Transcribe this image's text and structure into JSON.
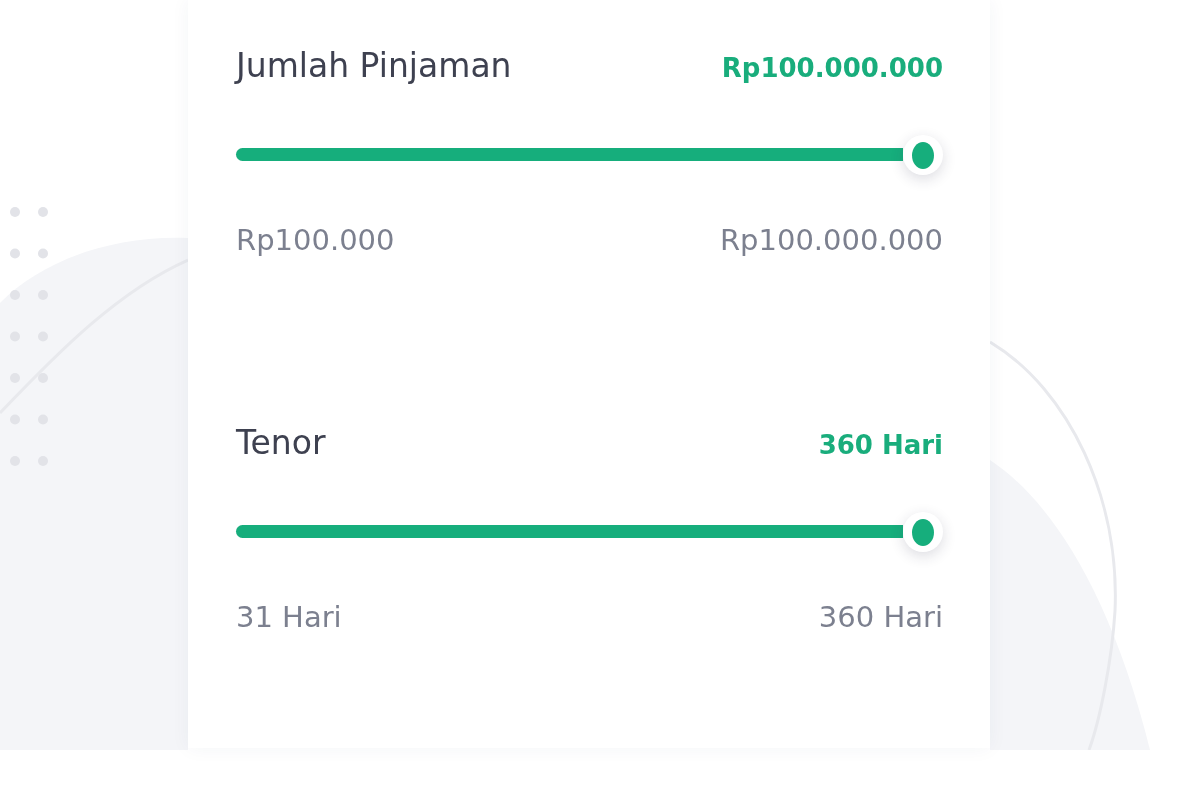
{
  "sliders": [
    {
      "label": "Jumlah Pinjaman",
      "value": "Rp100.000.000",
      "level": 1,
      "min_label": "Rp100.000",
      "max_label": "Rp100.000.000"
    },
    {
      "label": "Tenor",
      "value": "360 Hari",
      "level": 1,
      "min_label": "31 Hari",
      "max_label": "360 Hari"
    }
  ]
}
